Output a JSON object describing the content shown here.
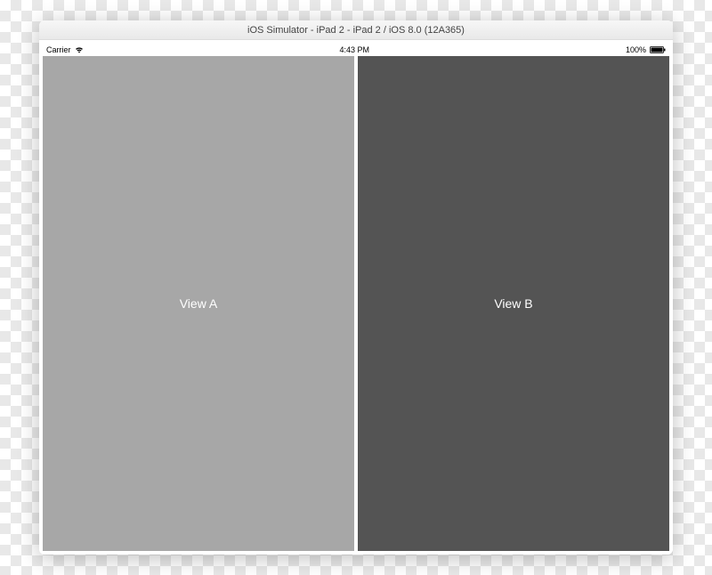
{
  "titlebar": {
    "title": "iOS Simulator - iPad 2 - iPad 2 / iOS 8.0 (12A365)"
  },
  "statusbar": {
    "carrier": "Carrier",
    "time": "4:43 PM",
    "battery_percent": "100%"
  },
  "views": {
    "a_label": "View A",
    "b_label": "View B"
  },
  "colors": {
    "view_a_bg": "#a7a7a7",
    "view_b_bg": "#545454"
  }
}
